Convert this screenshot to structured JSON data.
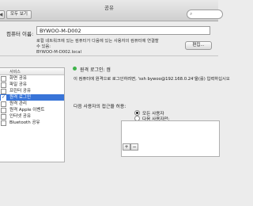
{
  "window": {
    "title": "공유"
  },
  "toolbar": {
    "back": "◀",
    "forward": "▶",
    "show_all": "모두 보기"
  },
  "computer_name": {
    "label": "컴퓨터 이름:",
    "value": "BYWOO-M-D002",
    "hint_line1": "로컬 네트워크에 있는 컴퓨터가 다음에 있는 사용자의 컴퓨터에 연결할 수 있음:",
    "hint_line2": "BYWOO-M-D002.local",
    "edit_button": "편집..."
  },
  "services": {
    "header": "서비스",
    "items": [
      {
        "label": "화면 공유",
        "checked": false
      },
      {
        "label": "파일 공유",
        "checked": false
      },
      {
        "label": "프린터 공유",
        "checked": false
      },
      {
        "label": "원격 로그인",
        "checked": true,
        "selected": true
      },
      {
        "label": "원격 관리",
        "checked": false
      },
      {
        "label": "원격 Apple 이벤트",
        "checked": false
      },
      {
        "label": "인터넷 공유",
        "checked": false
      },
      {
        "label": "Bluetooth 공유",
        "checked": false
      }
    ]
  },
  "status": {
    "title": "원격 로그인: 켬",
    "description": "이 컴퓨터에 원격으로 로그인하려면, 'ssh bywoo@192.168.0.24'을(를) 입력하십시오"
  },
  "access": {
    "label": "다음 사용자의 접근을 허용:",
    "options": [
      {
        "label": "모든 사용자",
        "selected": true
      },
      {
        "label": "다음 사용자만:",
        "selected": false
      }
    ]
  },
  "user_list_buttons": {
    "add": "+",
    "remove": "−"
  },
  "colors": {
    "selection": "#3874d8",
    "status_on": "#3fb34b"
  }
}
